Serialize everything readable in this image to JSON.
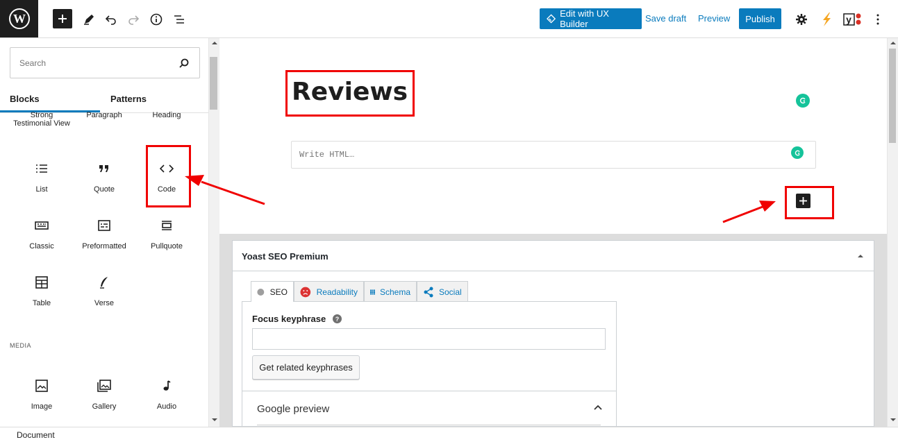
{
  "toolbar": {
    "edit_ux_label": "Edit with UX Builder",
    "save_draft_label": "Save draft",
    "preview_label": "Preview",
    "publish_label": "Publish",
    "accent_color": "#0a7bbd"
  },
  "sidebar": {
    "search_placeholder": "Search",
    "tabs": [
      {
        "label": "Blocks"
      },
      {
        "label": "Patterns"
      }
    ],
    "cut_blocks": [
      {
        "label": "Strong Testimonial View"
      },
      {
        "label": "Paragraph"
      },
      {
        "label": "Heading"
      }
    ],
    "blocks": [
      {
        "label": "List",
        "icon": "list-icon"
      },
      {
        "label": "Quote",
        "icon": "quote-icon"
      },
      {
        "label": "Code",
        "icon": "code-icon"
      },
      {
        "label": "Classic",
        "icon": "keyboard-icon"
      },
      {
        "label": "Preformatted",
        "icon": "preformatted-icon"
      },
      {
        "label": "Pullquote",
        "icon": "pullquote-icon"
      },
      {
        "label": "Table",
        "icon": "table-icon"
      },
      {
        "label": "Verse",
        "icon": "feather-icon"
      }
    ],
    "media_heading": "MEDIA",
    "media_blocks": [
      {
        "label": "Image",
        "icon": "image-icon"
      },
      {
        "label": "Gallery",
        "icon": "gallery-icon"
      },
      {
        "label": "Audio",
        "icon": "audio-icon"
      }
    ]
  },
  "editor": {
    "post_title": "Reviews",
    "html_placeholder": "Write HTML…"
  },
  "yoast": {
    "panel_title": "Yoast SEO Premium",
    "tabs": [
      {
        "label": "SEO"
      },
      {
        "label": "Readability"
      },
      {
        "label": "Schema"
      },
      {
        "label": "Social"
      }
    ],
    "focus_keyphrase_label": "Focus keyphrase",
    "related_button": "Get related keyphrases",
    "google_preview_label": "Google preview"
  },
  "footer": {
    "breadcrumb": "Document"
  },
  "annotation_color": "#f00000"
}
